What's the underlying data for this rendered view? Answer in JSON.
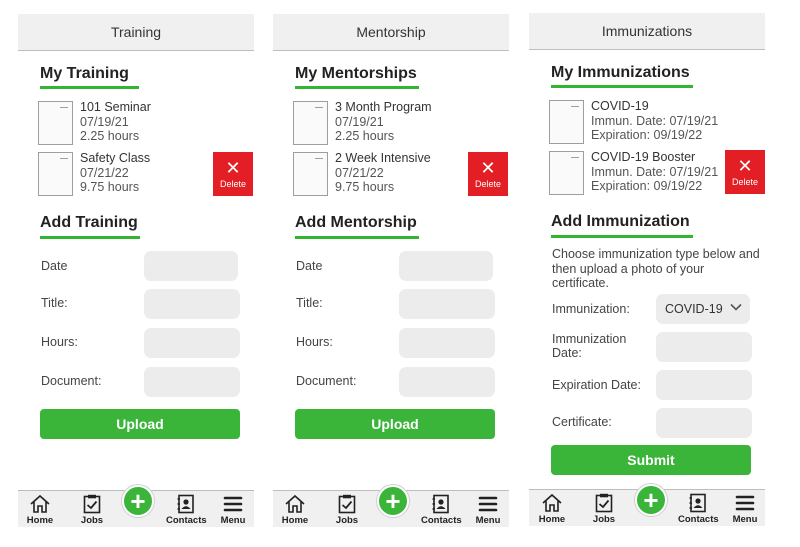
{
  "nav": {
    "home": "Home",
    "jobs": "Jobs",
    "contacts": "Contacts",
    "menu": "Menu",
    "add_symbol": "+"
  },
  "training": {
    "header": "Training",
    "list_title": "My Training",
    "records": [
      {
        "name": "101 Seminar",
        "date": "07/19/21",
        "hours": "2.25 hours"
      },
      {
        "name": "Safety Class",
        "date": "07/21/22",
        "hours": "9.75 hours"
      }
    ],
    "delete_label": "Delete",
    "form_title": "Add Training",
    "fields": [
      "Date",
      "Title:",
      "Hours:",
      "Document:"
    ],
    "submit_label": "Upload"
  },
  "mentorship": {
    "header": "Mentorship",
    "list_title": "My Mentorships",
    "records": [
      {
        "name": "3 Month Program",
        "date": "07/19/21",
        "hours": "2.25 hours"
      },
      {
        "name": "2 Week Intensive",
        "date": "07/21/22",
        "hours": "9.75 hours"
      }
    ],
    "delete_label": "Delete",
    "form_title": "Add Mentorship",
    "fields": [
      "Date",
      "Title:",
      "Hours:",
      "Document:"
    ],
    "submit_label": "Upload"
  },
  "immunizations": {
    "header": "Immunizations",
    "list_title": "My Immunizations",
    "records": [
      {
        "name": "COVID-19",
        "immun_date": "Immun. Date: 07/19/21",
        "expiration": "Expiration: 09/19/22"
      },
      {
        "name": "COVID-19 Booster",
        "immun_date": "Immun. Date: 07/19/21",
        "expiration": "Expiration: 09/19/22"
      }
    ],
    "delete_label": "Delete",
    "form_title": "Add Immunization",
    "description": "Choose immunization type below and then upload a photo of your certificate.",
    "immunization_label": "Immunization:",
    "immunization_selected": "COVID-19",
    "immunization_date_label": "Immunization Date:",
    "expiration_label": "Expiration Date:",
    "certificate_label": "Certificate:",
    "submit_label": "Submit"
  },
  "colors": {
    "accent": "#3ab53a",
    "delete": "#e31e24",
    "bar": "#f0f0f0",
    "field": "#ececec"
  }
}
